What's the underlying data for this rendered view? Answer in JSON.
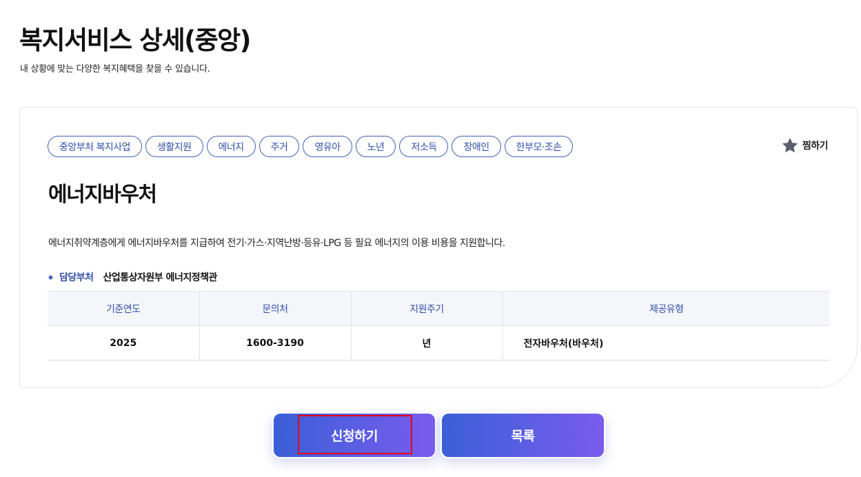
{
  "header": {
    "title": "복지서비스 상세(중앙)",
    "subtitle": "내 상황에 맞는 다양한 복지혜택을 찾을 수 있습니다."
  },
  "tags": [
    "중앙부처 복지사업",
    "생활지원",
    "에너지",
    "주거",
    "영유아",
    "노년",
    "저소득",
    "장애인",
    "한부모·조손"
  ],
  "favorite": {
    "label": "찜하기",
    "icon": "star-icon"
  },
  "service": {
    "title": "에너지바우처",
    "description": "에너지취약계층에게 에너지바우처를 지급하여 전기·가스·지역난방·등유·LPG 등 필요 에너지의 이용 비용을 지원합니다.",
    "dept_label": "담당부처",
    "dept_value": "산업통상자원부 에너지정책관"
  },
  "table": {
    "headers": [
      "기준연도",
      "문의처",
      "지원주기",
      "제공유형"
    ],
    "row": [
      "2025",
      "1600-3190",
      "년",
      "전자바우처(바우처)"
    ]
  },
  "buttons": {
    "apply": "신청하기",
    "list": "목록"
  },
  "colors": {
    "accent": "#2f4fa8",
    "button_gradient_start": "#3b5fd8",
    "button_gradient_end": "#7a5cec",
    "highlight": "#e60012"
  }
}
